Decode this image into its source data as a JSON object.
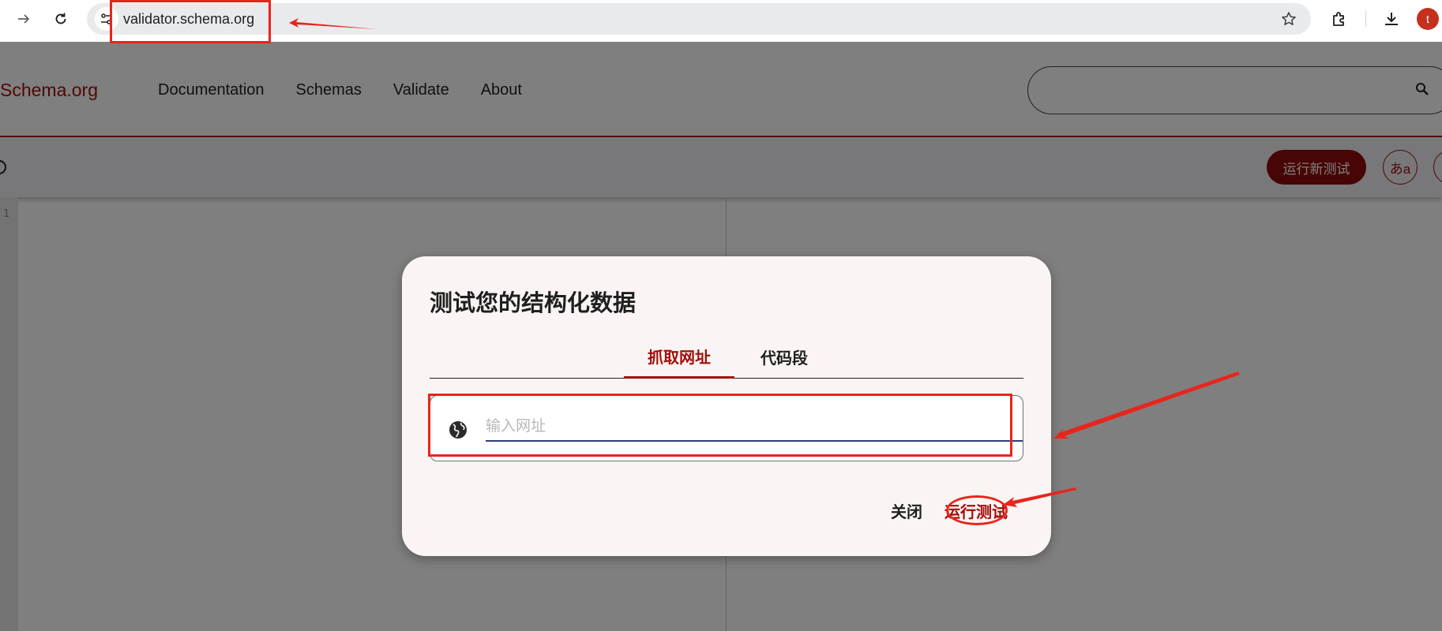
{
  "browser": {
    "url": "validator.schema.org",
    "profile_initial": "t"
  },
  "site": {
    "brand": "Schema.org",
    "nav": [
      "Documentation",
      "Schemas",
      "Validate",
      "About"
    ]
  },
  "toolbar": {
    "run_new_label": "运行新测试",
    "lang_label": "あa"
  },
  "editor": {
    "line_number": "1"
  },
  "dialog": {
    "title": "测试您的结构化数据",
    "tabs": [
      {
        "label": "抓取网址",
        "active": true
      },
      {
        "label": "代码段",
        "active": false
      }
    ],
    "url_value": "",
    "url_placeholder": "输入网址",
    "close_label": "关闭",
    "run_label": "运行测试"
  },
  "colors": {
    "brand": "#a30f0a",
    "run_button_bg": "#8f0b0b",
    "annotation": "#e8251c",
    "avatar": "#c4301c"
  }
}
